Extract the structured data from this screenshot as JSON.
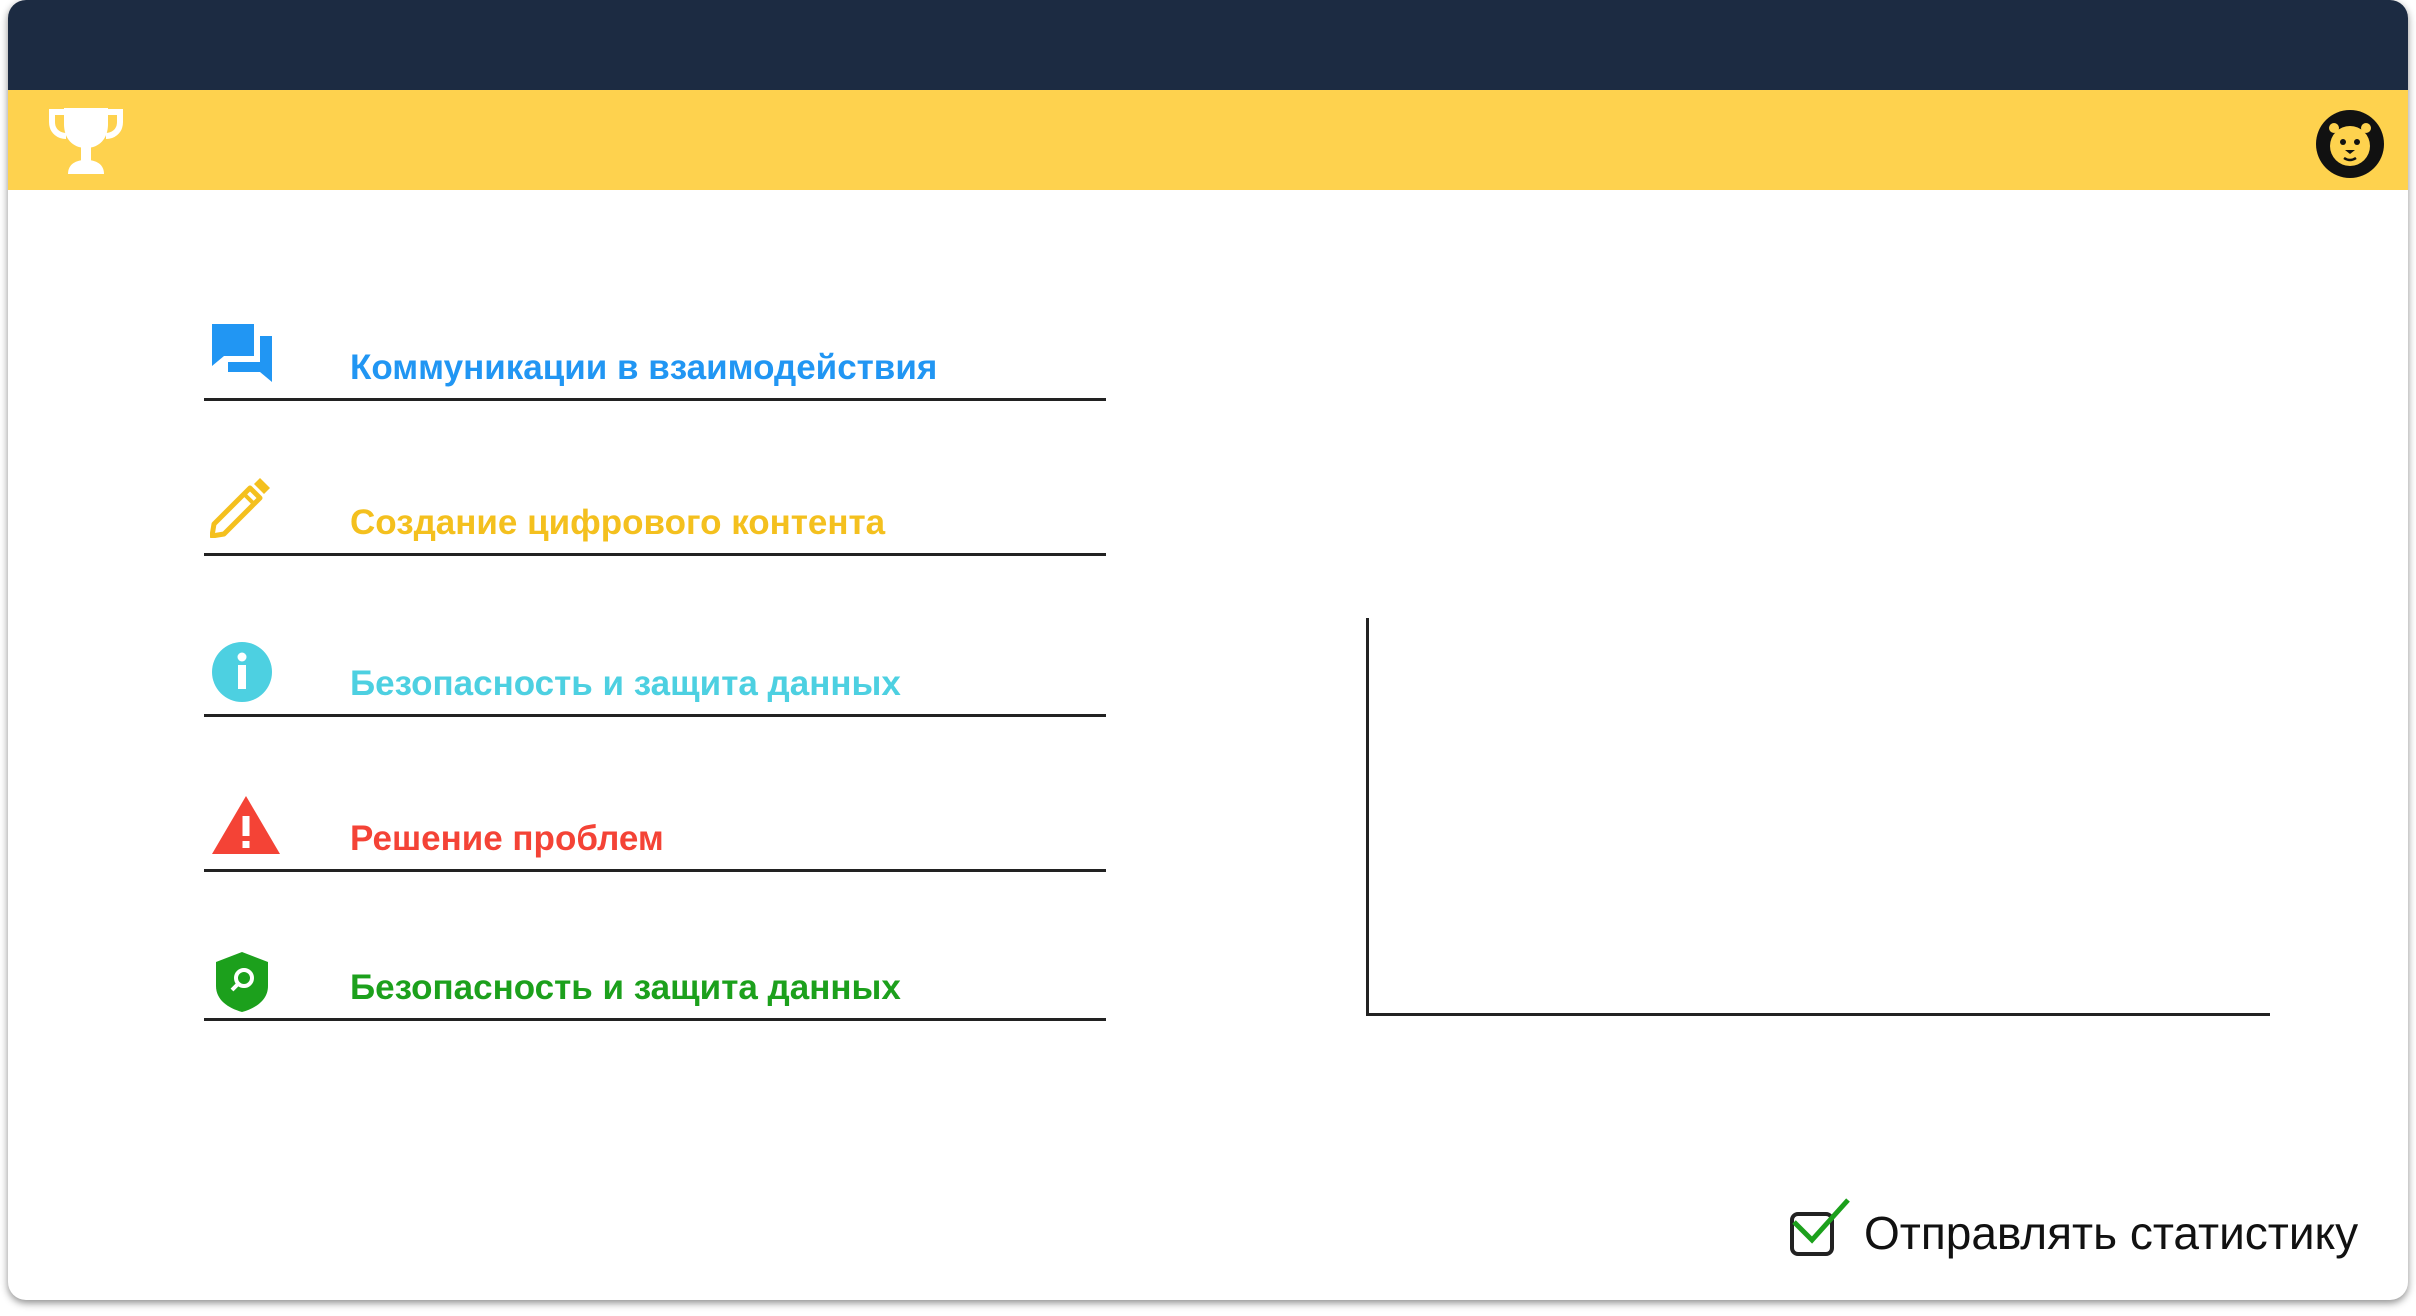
{
  "header": {
    "left_icon": "trophy-icon",
    "right_icon": "lion-avatar-icon",
    "bar_color": "#1c2b42",
    "accent_color": "#fed24e"
  },
  "categories": [
    {
      "label": "Коммуникации в взаимодействия",
      "icon": "chat-icon",
      "color": "#2196f3"
    },
    {
      "label": "Создание цифрового контента",
      "icon": "pencil-icon",
      "color": "#f4c01e"
    },
    {
      "label": "Безопасность и защита данных",
      "icon": "info-icon",
      "color": "#4dd0e1"
    },
    {
      "label": "Решение проблем",
      "icon": "warning-icon",
      "color": "#f44336"
    },
    {
      "label": "Безопасность и защита данных",
      "icon": "shield-search-icon",
      "color": "#1ca01c"
    }
  ],
  "footer": {
    "send_stats_label": "Отправлять статистику",
    "send_stats_checked": true
  }
}
